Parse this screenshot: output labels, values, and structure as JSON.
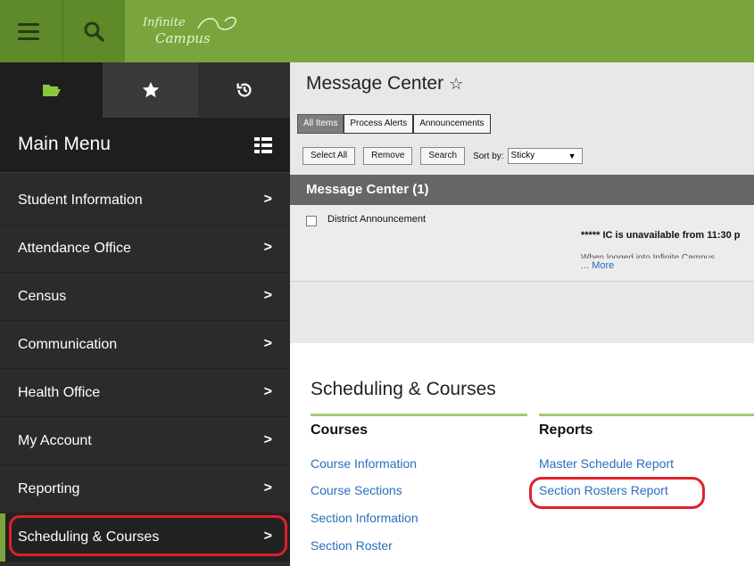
{
  "header": {
    "logo_line1": "Infinite",
    "logo_line2": "Campus"
  },
  "sidebar": {
    "title": "Main Menu",
    "items": [
      {
        "label": "Student Information",
        "chevron": ">"
      },
      {
        "label": "Attendance Office",
        "chevron": ">"
      },
      {
        "label": "Census",
        "chevron": ">"
      },
      {
        "label": "Communication",
        "chevron": ">"
      },
      {
        "label": "Health Office",
        "chevron": ">"
      },
      {
        "label": "My Account",
        "chevron": ">"
      },
      {
        "label": "Reporting",
        "chevron": ">"
      },
      {
        "label": "Scheduling & Courses",
        "chevron": ">"
      }
    ]
  },
  "message_center": {
    "title": "Message Center",
    "star": "☆",
    "tabs": [
      "All Items",
      "Process Alerts",
      "Announcements"
    ],
    "buttons": [
      "Select All",
      "Remove",
      "Search"
    ],
    "sort_label": "Sort by:",
    "sort_value": "Sticky",
    "bar_title": "Message Center (1)",
    "message": {
      "type": "District Announcement",
      "body": "***** IC is unavailable from 11:30 p",
      "cut_text": "When logged into Infinite Campus",
      "more": "... More"
    }
  },
  "scheduling": {
    "title": "Scheduling & Courses",
    "courses_head": "Courses",
    "courses_links": [
      "Course Information",
      "Course Sections",
      "Section Information",
      "Section Roster"
    ],
    "reports_head": "Reports",
    "reports_links": [
      "Master Schedule Report",
      "Section Rosters Report"
    ]
  },
  "colors": {
    "brand_green": "#7aa53c",
    "highlight_red": "#e0202a",
    "link_blue": "#2a6ebb"
  }
}
